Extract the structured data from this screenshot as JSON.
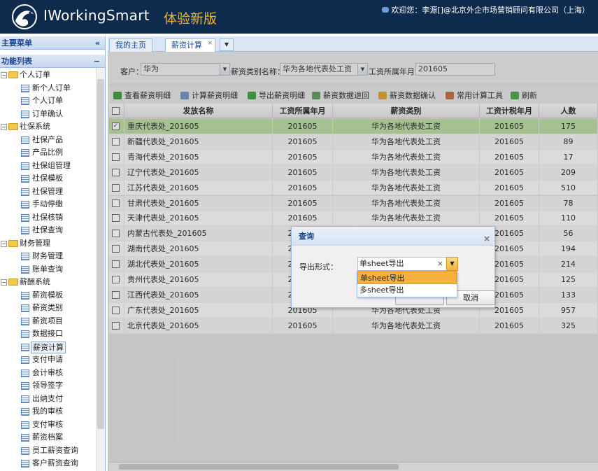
{
  "header": {
    "app_name": "IWorkingSmart",
    "version_label": "体验新版",
    "welcome_text": "欢迎您：李源[]@北京外企市场营销顾问有限公司（上海）"
  },
  "sidebar": {
    "title": "主要菜单",
    "collapse_glyph": "«",
    "section_title": "功能列表",
    "section_collapse_glyph": "−",
    "tree": [
      {
        "type": "folder",
        "label": "个人订单"
      },
      {
        "type": "leaf",
        "label": "新个人订单"
      },
      {
        "type": "leaf",
        "label": "个人订单"
      },
      {
        "type": "leaf",
        "label": "订单确认"
      },
      {
        "type": "folder",
        "label": "社保系统"
      },
      {
        "type": "leaf",
        "label": "社保产品"
      },
      {
        "type": "leaf",
        "label": "产品比例"
      },
      {
        "type": "leaf",
        "label": "社保组管理"
      },
      {
        "type": "leaf",
        "label": "社保模板"
      },
      {
        "type": "leaf",
        "label": "社保管理"
      },
      {
        "type": "leaf",
        "label": "手动停缴"
      },
      {
        "type": "leaf",
        "label": "社保核销"
      },
      {
        "type": "leaf",
        "label": "社保查询"
      },
      {
        "type": "folder",
        "label": "财务管理"
      },
      {
        "type": "leaf",
        "label": "财务管理"
      },
      {
        "type": "leaf",
        "label": "账单查询"
      },
      {
        "type": "folder",
        "label": "薪酬系统"
      },
      {
        "type": "leaf",
        "label": "薪资模板"
      },
      {
        "type": "leaf",
        "label": "薪资类别"
      },
      {
        "type": "leaf",
        "label": "薪资项目"
      },
      {
        "type": "leaf",
        "label": "数据接口"
      },
      {
        "type": "leaf",
        "label": "薪资计算",
        "selected": true
      },
      {
        "type": "leaf",
        "label": "支付申请"
      },
      {
        "type": "leaf",
        "label": "会计审核"
      },
      {
        "type": "leaf",
        "label": "领导签字"
      },
      {
        "type": "leaf",
        "label": "出纳支付"
      },
      {
        "type": "leaf",
        "label": "我的审核"
      },
      {
        "type": "leaf",
        "label": "支付审核"
      },
      {
        "type": "leaf",
        "label": "薪资档案"
      },
      {
        "type": "leaf",
        "label": "员工薪资查询"
      },
      {
        "type": "leaf",
        "label": "客户薪资查询"
      }
    ]
  },
  "tabs": [
    {
      "label": "我的主页"
    },
    {
      "label": "薪资计算",
      "active": true,
      "close": "×"
    }
  ],
  "filter": {
    "customer_label": "客户：",
    "customer_value": "华为",
    "category_label": "薪资类别名称：",
    "category_value": "华为各地代表处工资",
    "month_label": "工资所属年月：",
    "month_value": "201605"
  },
  "toolbar": [
    {
      "label": "查看薪资明细",
      "color": "#3a9a3a"
    },
    {
      "label": "计算薪资明细",
      "color": "#6d8fbf"
    },
    {
      "label": "导出薪资明细",
      "color": "#3aa03a"
    },
    {
      "label": "薪资数据退回",
      "color": "#5a9a5a"
    },
    {
      "label": "薪资数据确认",
      "color": "#e0a020"
    },
    {
      "label": "常用计算工具",
      "color": "#c56a3a"
    },
    {
      "label": "刷新",
      "color": "#4aa04a"
    }
  ],
  "grid": {
    "columns": [
      "发放名称",
      "工资所属年月",
      "薪资类别",
      "工资计税年月",
      "人数"
    ],
    "rows": [
      {
        "name": "重庆代表处_201605",
        "month": "201605",
        "category": "华为各地代表处工资",
        "tax_month": "201605",
        "count": "175",
        "checked": true
      },
      {
        "name": "新疆代表处_201605",
        "month": "201605",
        "category": "华为各地代表处工资",
        "tax_month": "201605",
        "count": "89"
      },
      {
        "name": "青海代表处_201605",
        "month": "201605",
        "category": "华为各地代表处工资",
        "tax_month": "201605",
        "count": "17"
      },
      {
        "name": "辽宁代表处_201605",
        "month": "201605",
        "category": "华为各地代表处工资",
        "tax_month": "201605",
        "count": "209"
      },
      {
        "name": "江苏代表处_201605",
        "month": "201605",
        "category": "华为各地代表处工资",
        "tax_month": "201605",
        "count": "510"
      },
      {
        "name": "甘肃代表处_201605",
        "month": "201605",
        "category": "华为各地代表处工资",
        "tax_month": "201605",
        "count": "78"
      },
      {
        "name": "天津代表处_201605",
        "month": "201605",
        "category": "华为各地代表处工资",
        "tax_month": "201605",
        "count": "110"
      },
      {
        "name": "内蒙古代表处_201605",
        "month": "201605",
        "category": "华为各地代表处工资",
        "tax_month": "201605",
        "count": "56"
      },
      {
        "name": "湖南代表处_201605",
        "month": "201605",
        "category": "华为各地代表处工资",
        "tax_month": "201605",
        "count": "194"
      },
      {
        "name": "湖北代表处_201605",
        "month": "201605",
        "category": "华为各地代表处工资",
        "tax_month": "201605",
        "count": "214"
      },
      {
        "name": "贵州代表处_201605",
        "month": "201605",
        "category": "华为各地代表处工资",
        "tax_month": "201605",
        "count": "125"
      },
      {
        "name": "江西代表处_201605",
        "month": "201605",
        "category": "华为各地代表处工资",
        "tax_month": "201605",
        "count": "133"
      },
      {
        "name": "广东代表处_201605",
        "month": "201605",
        "category": "华为各地代表处工资",
        "tax_month": "201605",
        "count": "957"
      },
      {
        "name": "北京代表处_201605",
        "month": "201605",
        "category": "华为各地代表处工资",
        "tax_month": "201605",
        "count": "325"
      }
    ]
  },
  "dialog": {
    "title": "查询",
    "close": "×",
    "field_label": "导出形式：",
    "selected_value": "单sheet导出",
    "clear_glyph": "×",
    "options": [
      "单sheet导出",
      "多sheet导出"
    ],
    "cancel_label": "取消"
  },
  "colors": {
    "header_bg": "#0e2a4c",
    "accent": "#f2b51d",
    "selected_row": "#b9dba0"
  }
}
